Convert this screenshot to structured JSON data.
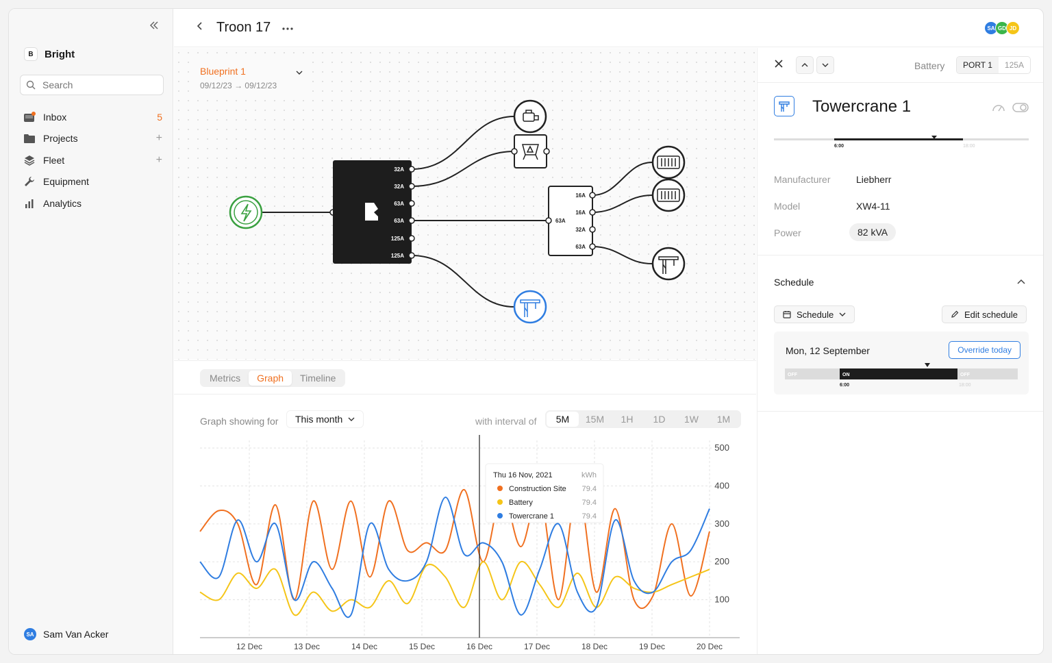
{
  "sidebar": {
    "brand": "Bright",
    "brand_logo": "B",
    "search_placeholder": "Search",
    "items": [
      {
        "label": "Inbox",
        "icon": "inbox-icon",
        "badge": "5"
      },
      {
        "label": "Projects",
        "icon": "folder-icon",
        "trail": "+"
      },
      {
        "label": "Fleet",
        "icon": "layers-icon",
        "trail": "+"
      },
      {
        "label": "Equipment",
        "icon": "wrench-icon"
      },
      {
        "label": "Analytics",
        "icon": "bar-chart-icon"
      }
    ],
    "user": {
      "name": "Sam Van Acker",
      "initials": "SA"
    }
  },
  "header": {
    "title": "Troon 17",
    "avatars": [
      {
        "initials": "SA",
        "color": "#2f7de1"
      },
      {
        "initials": "GD",
        "color": "#3ab54a"
      },
      {
        "initials": "JD",
        "color": "#f5c518"
      }
    ]
  },
  "blueprint": {
    "title": "Blueprint 1",
    "date_from": "09/12/23",
    "date_to": "09/12/23",
    "main_ports": [
      "32A",
      "32A",
      "63A",
      "63A",
      "125A",
      "125A"
    ],
    "dist_input": "63A",
    "dist_ports": [
      "16A",
      "16A",
      "32A",
      "63A"
    ]
  },
  "graph": {
    "tabs": [
      "Metrics",
      "Graph",
      "Timeline"
    ],
    "active_tab": "Graph",
    "showing_label": "Graph showing for",
    "period": "This month",
    "interval_label": "with interval of",
    "intervals": [
      "5M",
      "15M",
      "1H",
      "1D",
      "1W",
      "1M"
    ],
    "active_interval": "5M"
  },
  "chart_data": {
    "type": "line",
    "x": [
      "12 Dec",
      "13 Dec",
      "14 Dec",
      "15 Dec",
      "16 Dec",
      "17 Dec",
      "18 Dec",
      "19 Dec",
      "20 Dec"
    ],
    "yticks": [
      100,
      200,
      300,
      400,
      500
    ],
    "ylim": [
      0,
      520
    ],
    "grid": true,
    "series": [
      {
        "name": "Construction Site",
        "color": "#f07020",
        "values": [
          280,
          335,
          300,
          140,
          350,
          100,
          360,
          180,
          360,
          160,
          360,
          230,
          250,
          230,
          390,
          200,
          380,
          240,
          380,
          100,
          400,
          120,
          340,
          100,
          110,
          300,
          110,
          280
        ]
      },
      {
        "name": "Battery",
        "color": "#f5c518",
        "values": [
          120,
          100,
          170,
          130,
          180,
          60,
          120,
          70,
          100,
          80,
          150,
          90,
          190,
          160,
          80,
          200,
          100,
          200,
          140,
          80,
          170,
          80,
          160,
          130,
          120,
          140,
          160,
          180
        ]
      },
      {
        "name": "Towercrane 1",
        "color": "#2f7de1",
        "values": [
          200,
          160,
          310,
          200,
          300,
          100,
          200,
          130,
          60,
          300,
          180,
          150,
          200,
          370,
          220,
          250,
          200,
          60,
          180,
          300,
          120,
          80,
          310,
          150,
          120,
          200,
          230,
          340
        ]
      }
    ],
    "tooltip": {
      "date": "Thu 16 Nov, 2021",
      "unit": "kWh",
      "rows": [
        {
          "name": "Construction Site",
          "value": "79.4",
          "color": "#f07020"
        },
        {
          "name": "Battery",
          "value": "79.4",
          "color": "#f5c518"
        },
        {
          "name": "Towercrane 1",
          "value": "79.4",
          "color": "#2f7de1"
        }
      ]
    }
  },
  "details": {
    "type": "Battery",
    "port": "PORT 1",
    "amps": "125A",
    "title": "Towercrane 1",
    "timeline_start": "6:00",
    "timeline_end": "18:00",
    "properties": [
      {
        "key": "Manufacturer",
        "value": "Liebherr"
      },
      {
        "key": "Model",
        "value": "XW4-11"
      },
      {
        "key": "Power",
        "value": "82 kVA"
      }
    ],
    "schedule": {
      "title": "Schedule",
      "dropdown": "Schedule",
      "edit": "Edit schedule",
      "date": "Mon, 12 September",
      "override": "Override today",
      "seg_off": "OFF",
      "seg_on": "ON",
      "seg_off2": "OFF",
      "time_start": "6:00",
      "time_end": "18:00"
    }
  },
  "colors": {
    "accent": "#f07020",
    "blue": "#2f7de1",
    "green": "#3aa040"
  }
}
